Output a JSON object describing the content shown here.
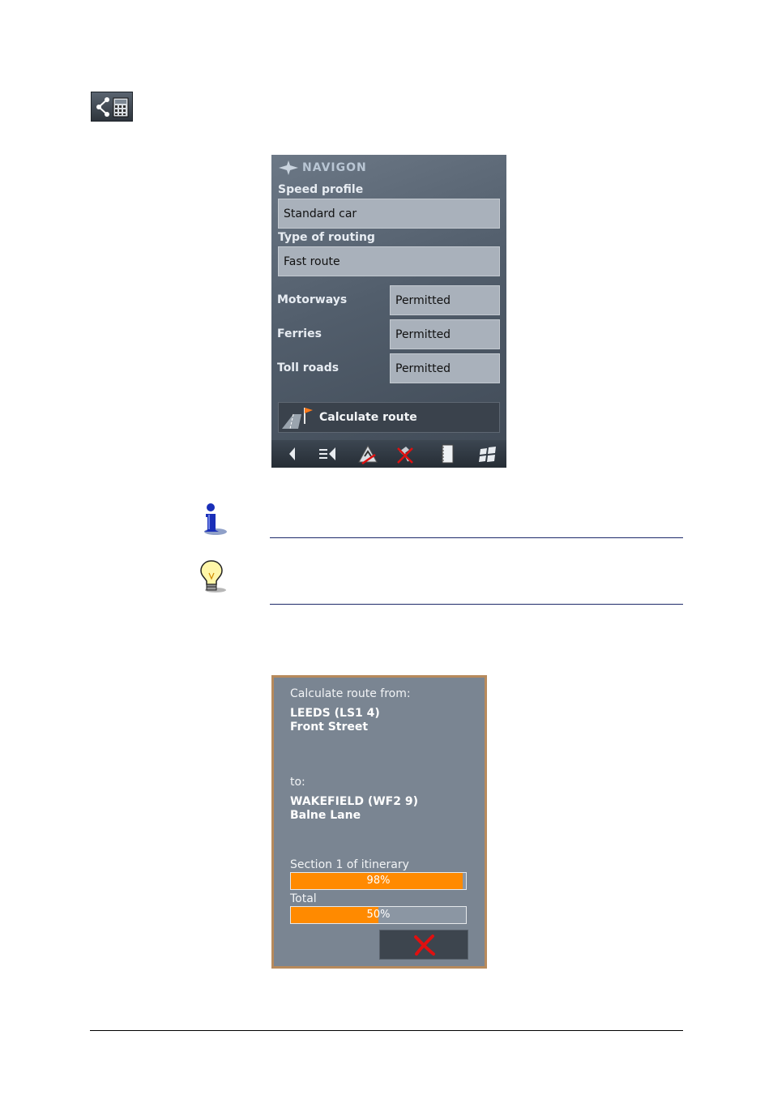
{
  "icons": {
    "route_options": "route-calculator-icon",
    "info": "info-figure-icon",
    "tip": "light-bulb-icon"
  },
  "screen1": {
    "brand": "NAVIGON",
    "speed_profile": {
      "label": "Speed profile",
      "value": "Standard car"
    },
    "routing_type": {
      "label": "Type of routing",
      "value": "Fast route"
    },
    "options": [
      {
        "label": "Motorways",
        "value": "Permitted"
      },
      {
        "label": "Ferries",
        "value": "Permitted"
      },
      {
        "label": "Toll roads",
        "value": "Permitted"
      }
    ],
    "calculate_button": "Calculate route",
    "toolbar_icons": [
      "back-arrow-icon",
      "menu-icon",
      "warning-icon",
      "gps-off-icon",
      "notebook-icon",
      "windows-icon"
    ]
  },
  "screen2": {
    "from_label": "Calculate route from:",
    "from_city": "LEEDS (LS1 4)",
    "from_street": "Front Street",
    "to_label": "to:",
    "to_city": "WAKEFIELD (WF2 9)",
    "to_street": "Balne Lane",
    "section_label": "Section 1 of itinerary",
    "section_progress": 98,
    "section_text": "98%",
    "total_label": "Total",
    "total_progress": 50,
    "total_text": "50%"
  },
  "colors": {
    "progress": "#ff8a00",
    "cancel_x": "#e01010",
    "rule": "#1d2a6a"
  }
}
